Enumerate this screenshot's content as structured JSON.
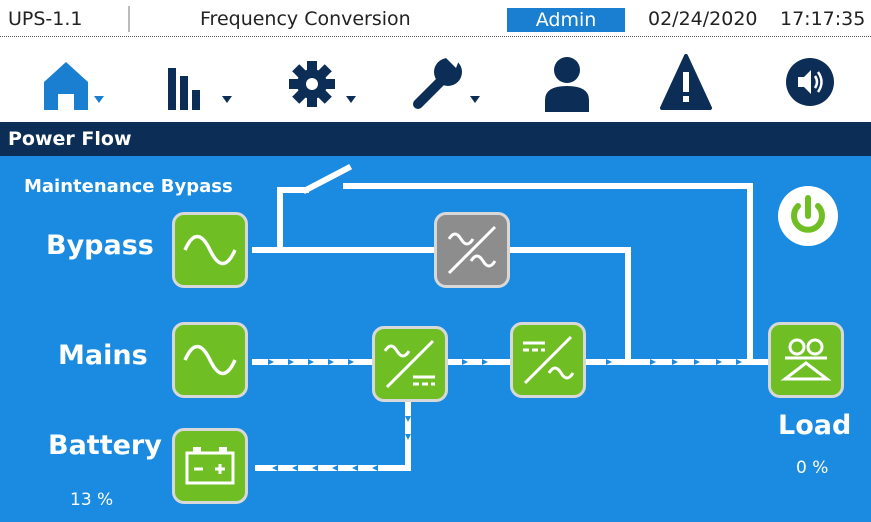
{
  "header": {
    "device_name": "UPS-1.1",
    "mode": "Frequency Conversion",
    "user": "Admin",
    "date": "02/24/2020",
    "time": "17:17:35"
  },
  "nav_icons": [
    {
      "name": "home-icon",
      "dropdown": true
    },
    {
      "name": "bar-chart-icon",
      "dropdown": true
    },
    {
      "name": "gear-icon",
      "dropdown": true
    },
    {
      "name": "wrench-icon",
      "dropdown": true
    },
    {
      "name": "user-icon",
      "dropdown": false
    },
    {
      "name": "warning-icon",
      "dropdown": false
    },
    {
      "name": "speaker-icon",
      "dropdown": false
    }
  ],
  "section": {
    "title": "Power Flow"
  },
  "flow": {
    "maintenance_bypass": "Maintenance Bypass",
    "bypass": "Bypass",
    "mains": "Mains",
    "battery": "Battery",
    "battery_percent": "13 %",
    "load": "Load",
    "load_percent": "0 %"
  },
  "colors": {
    "header_bg": "#0c2d55",
    "flow_bg": "#1a8be0",
    "accent_blue": "#1b7fd1",
    "icon_navy": "#0c2d55",
    "active_green": "#6fbf24",
    "inactive_gray": "#8d8d8d"
  }
}
